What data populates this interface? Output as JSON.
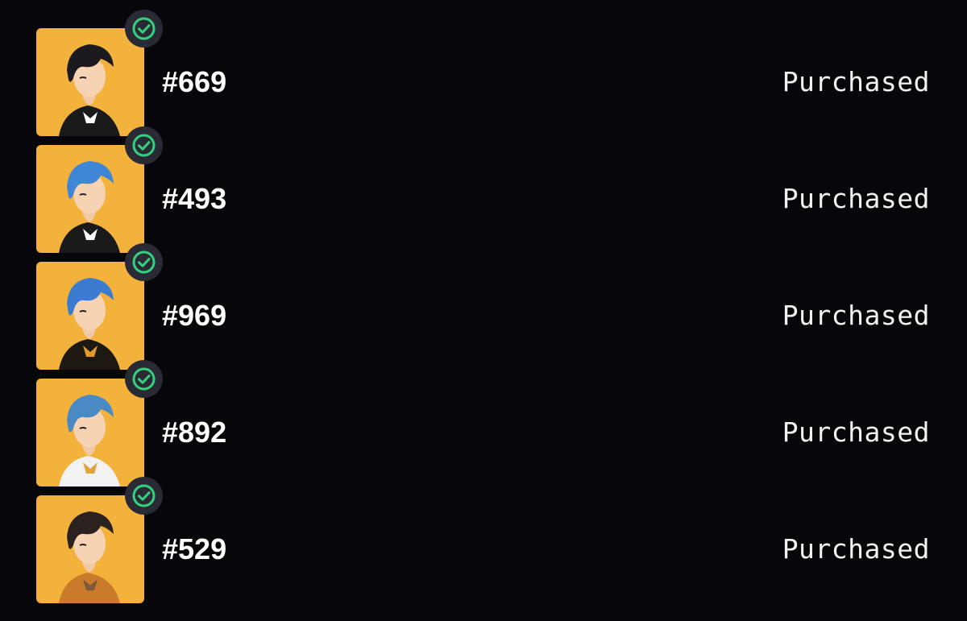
{
  "items": [
    {
      "id": "#669",
      "status": "Purchased",
      "hair_color": "#1c1a1f",
      "outfit_color": "#1a1a1a",
      "accent_color": "#ffffff"
    },
    {
      "id": "#493",
      "status": "Purchased",
      "hair_color": "#3f86d6",
      "outfit_color": "#1a1a1a",
      "accent_color": "#ffffff"
    },
    {
      "id": "#969",
      "status": "Purchased",
      "hair_color": "#3b7cd0",
      "outfit_color": "#1d1812",
      "accent_color": "#e39a2a"
    },
    {
      "id": "#892",
      "status": "Purchased",
      "hair_color": "#4a8ac4",
      "outfit_color": "#f2f2f2",
      "accent_color": "#e3a23a"
    },
    {
      "id": "#529",
      "status": "Purchased",
      "hair_color": "#2b2220",
      "outfit_color": "#c97a2a",
      "accent_color": "#7a5a3a"
    }
  ],
  "colors": {
    "background": "#07060b",
    "thumb_background": "#f3b23c",
    "badge_background": "#2a2a34",
    "check_color": "#35d07f"
  },
  "icons": {
    "badge": "check-circle-icon",
    "thumbnail": "avatar-portrait"
  }
}
